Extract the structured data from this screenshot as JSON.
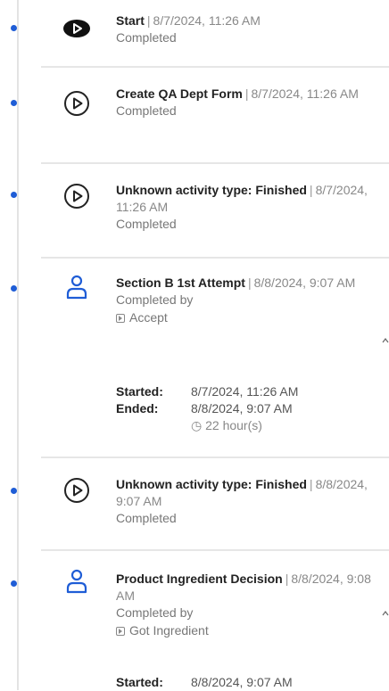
{
  "timeline": [
    {
      "icon": "play-filled",
      "title": "Start",
      "date": "8/7/2024, 11:26 AM",
      "status": "Completed"
    },
    {
      "icon": "play-outline",
      "title": "Create QA Dept Form",
      "date": "8/7/2024, 11:26 AM",
      "status": "Completed"
    },
    {
      "icon": "play-outline",
      "title": "Unknown activity type: Finished",
      "date": "8/7/2024, 11:26 AM",
      "status": "Completed"
    },
    {
      "icon": "user",
      "title": "Section B 1st Attempt",
      "date": "8/8/2024, 9:07 AM",
      "status": "Completed by",
      "action": "Accept",
      "started_label": "Started:",
      "started": "8/7/2024, 11:26 AM",
      "ended_label": "Ended:",
      "ended": "8/8/2024, 9:07 AM",
      "duration": "22 hour(s)"
    },
    {
      "icon": "play-outline",
      "title": "Unknown activity type: Finished",
      "date": "8/8/2024, 9:07 AM",
      "status": "Completed"
    },
    {
      "icon": "user",
      "title": "Product Ingredient Decision",
      "date": "8/8/2024, 9:08 AM",
      "status": "Completed by",
      "action": "Got Ingredient",
      "started_label": "Started:",
      "started": "8/8/2024, 9:07 AM"
    }
  ],
  "colors": {
    "accent": "#1f5dd6",
    "dot": "#1f5dd6",
    "divider": "#e6e6e6"
  }
}
